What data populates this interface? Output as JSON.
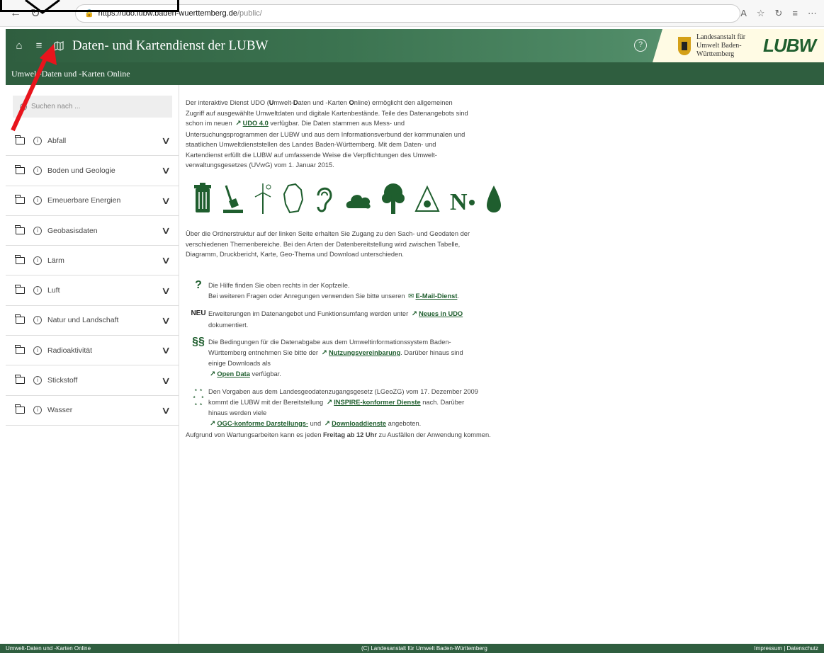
{
  "browser": {
    "url_host": "https://udo.lubw.baden-wuerttemberg.de",
    "url_path": "/public/"
  },
  "header": {
    "title": "Daten- und Kartendienst der LUBW",
    "org_name": "Landesanstalt für Umwelt Baden-Württemberg",
    "logo_text": "LUBW",
    "sub_title": "Umwelt-Daten und -Karten Online"
  },
  "sidebar": {
    "search_placeholder": "Suchen nach ...",
    "items": [
      {
        "label": "Abfall"
      },
      {
        "label": "Boden und Geologie"
      },
      {
        "label": "Erneuerbare Energien"
      },
      {
        "label": "Geobasisdaten"
      },
      {
        "label": "Lärm"
      },
      {
        "label": "Luft"
      },
      {
        "label": "Natur und Landschaft"
      },
      {
        "label": "Radioaktivität"
      },
      {
        "label": "Stickstoff"
      },
      {
        "label": "Wasser"
      }
    ]
  },
  "main": {
    "intro_1": "Der interaktive Dienst UDO (",
    "intro_u": "U",
    "intro_2": "mwelt-",
    "intro_d": "D",
    "intro_3": "aten und -Karten ",
    "intro_o": "O",
    "intro_4": "nline) ermöglicht den allgemeinen Zugriff auf ausgewählte Umweltdaten und digitale Kartenbestände. Teile des Datenangebots sind schon im neuen",
    "udo_link": "UDO 4.0",
    "intro_5": "verfügbar. Die Daten stammen aus Mess- und Untersuchungsprogrammen der LUBW und aus dem Informationsverbund der kommunalen und staatlichen Umweltdienststellen des Landes Baden-Württemberg. Mit dem Daten- und Kartendienst erfüllt die LUBW auf umfassende Weise die Verpflichtungen des Umwelt-verwaltungsgesetzes (UVwG) vom 1. Januar 2015.",
    "para2": "Über die Ordnerstruktur auf der linken Seite erhalten Sie Zugang zu den Sach- und Geodaten der verschiedenen Themenbereiche. Bei den Arten der Datenbereitstellung wird zwischen Tabelle, Diagramm, Druckbericht, Karte, Geo-Thema und Download unterschieden.",
    "help_mark": "?",
    "help_1": "Die Hilfe finden Sie oben rechts in der Kopfzeile.",
    "help_2": "Bei weiteren Fragen oder Anregungen verwenden Sie bitte unseren",
    "email_link": "E-Mail-Dienst",
    "neu_mark": "NEU",
    "neu_1": "Erweiterungen im Datenangebot und Funktionsumfang werden unter",
    "neu_link": "Neues in UDO",
    "neu_2": "dokumentiert.",
    "para_mark": "§§",
    "law_1": "Die Bedingungen für die Datenabgabe aus dem Umweltinformationssystem Baden-Württemberg entnehmen Sie bitte der",
    "law_link": "Nutzungsvereinbarung",
    "law_2": ". Darüber hinaus sind einige Downloads als",
    "open_link": "Open Data",
    "law_3": "verfügbar.",
    "inspire_1": "Den Vorgaben aus dem Landesgeodatenzugangsgesetz (LGeoZG) vom 17. Dezember 2009 kommt die LUBW mit der Bereitstellung",
    "inspire_link": "INSPIRE-konformer Dienste",
    "inspire_2": "nach. Darüber hinaus werden viele",
    "ogc_link": "OGC-konforme Darstellungs-",
    "inspire_3": "und",
    "dl_link": "Downloaddienste",
    "inspire_4": "angeboten.",
    "maint_1": "Aufgrund von Wartungsarbeiten kann es jeden",
    "maint_b": "Freitag ab 12 Uhr",
    "maint_2": "zu Ausfällen der Anwendung kommen."
  },
  "footer": {
    "left": "Umwelt-Daten und -Karten Online",
    "center": "(C) Landesanstalt für Umwelt Baden-Württemberg",
    "right": "Impressum | Datenschutz"
  },
  "colors": {
    "brand_green": "#2f5e3f",
    "accent": "#1f5e2e",
    "annotation": "#e8141c"
  }
}
